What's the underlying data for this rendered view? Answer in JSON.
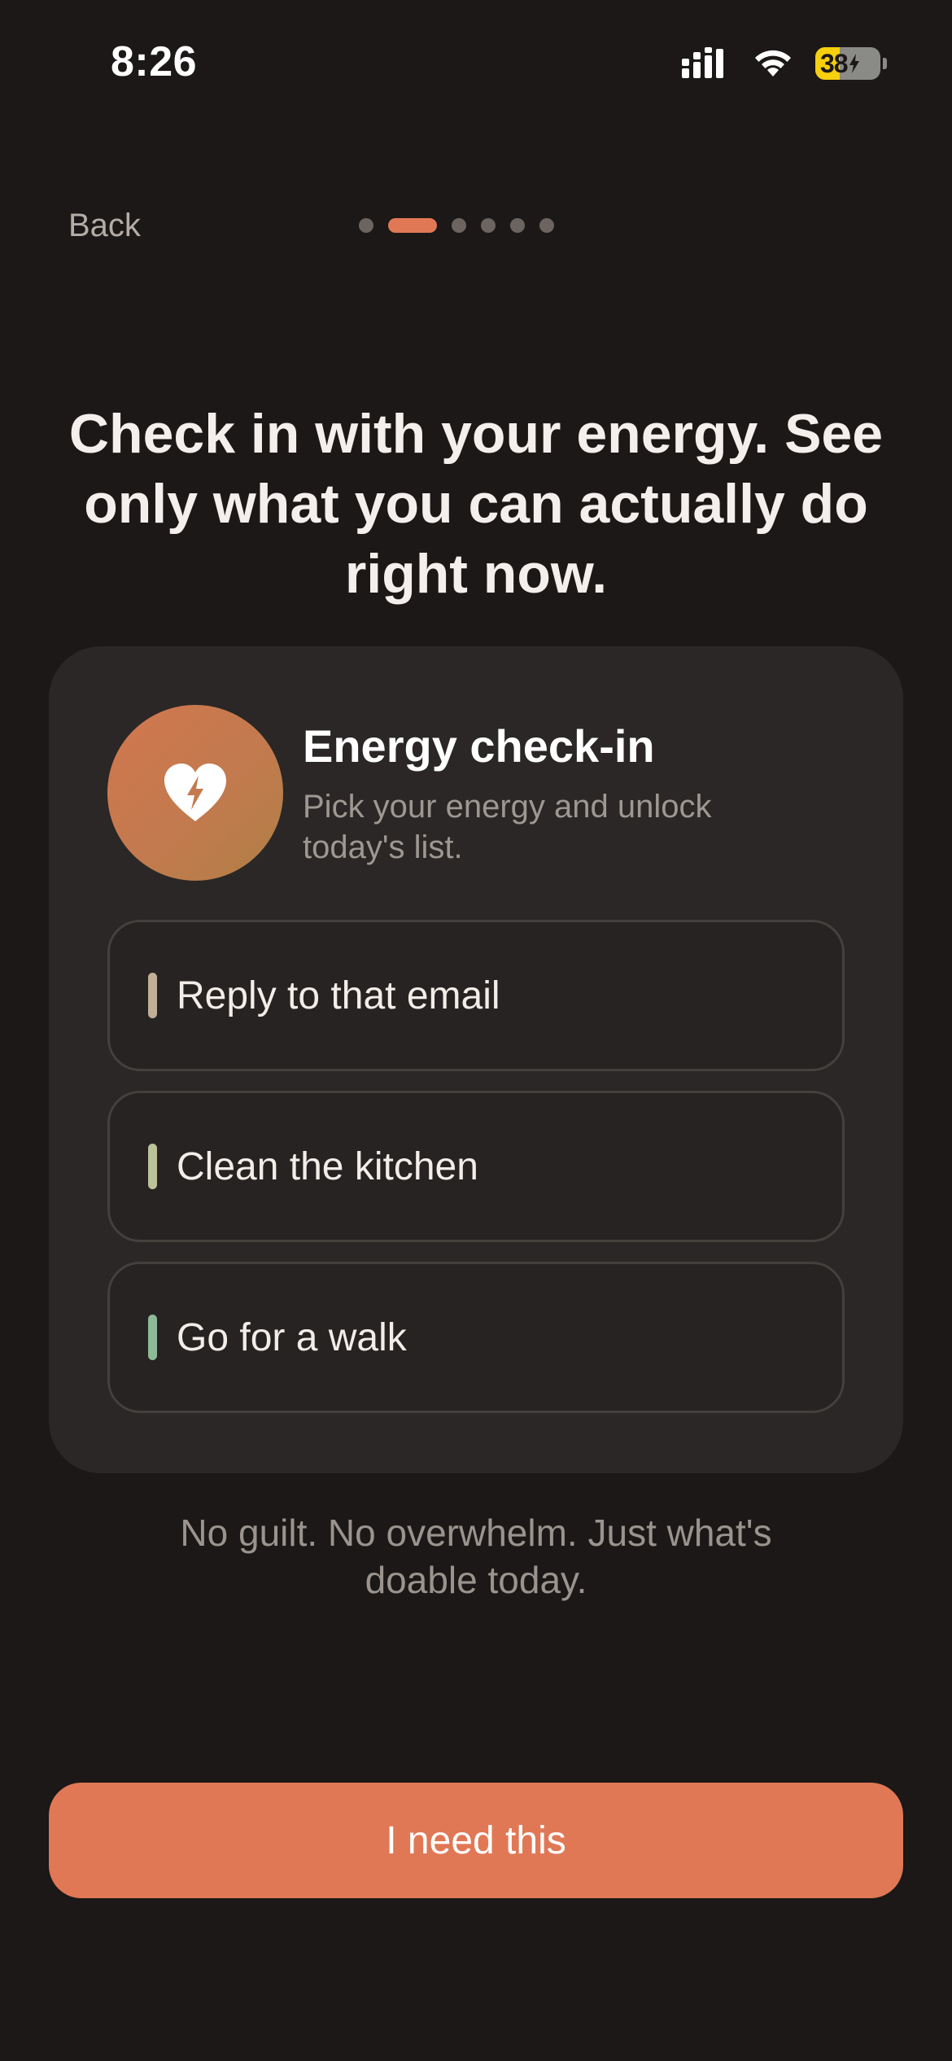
{
  "status_bar": {
    "time": "8:26",
    "battery_level": "38",
    "battery_fraction": 0.38,
    "battery_color": "#f6cf0d",
    "icons": [
      "signal-icon",
      "wifi-icon",
      "battery-icon"
    ]
  },
  "nav": {
    "back_label": "Back",
    "pager": {
      "total": 6,
      "current": 2
    }
  },
  "headline": "Check in with your energy. See only what you can actually do right now.",
  "card": {
    "icon": "heart-bolt-icon",
    "title": "Energy check-in",
    "subtitle": "Pick your energy and unlock today's list.",
    "tasks": [
      {
        "label": "Reply to that email",
        "color": "#c3ae96"
      },
      {
        "label": "Clean the kitchen",
        "color": "#bcc299"
      },
      {
        "label": "Go for a walk",
        "color": "#8dba97"
      }
    ]
  },
  "footnote": "No guilt. No overwhelm. Just what's doable today.",
  "cta_label": "I need this",
  "colors": {
    "background": "#1b1817",
    "card": "#2a2726",
    "accent": "#e07856"
  }
}
